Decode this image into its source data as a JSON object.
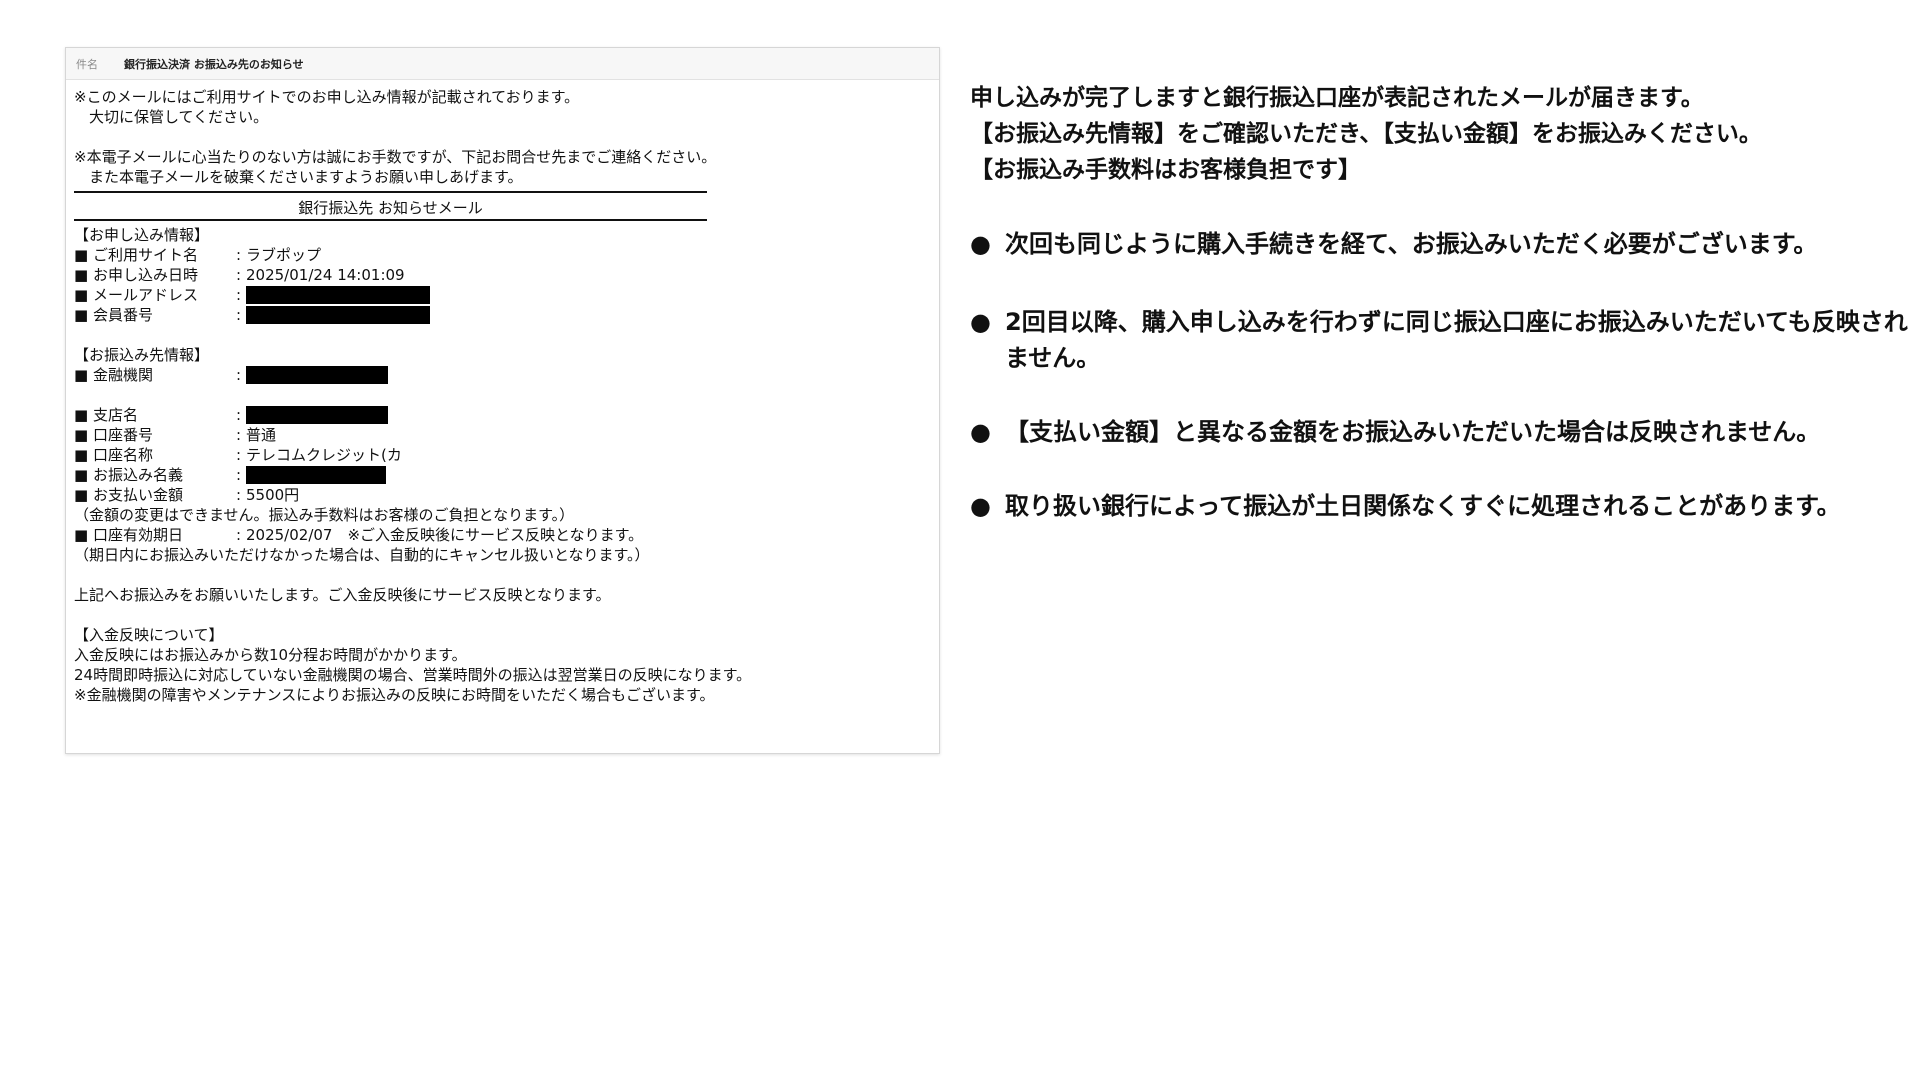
{
  "mail": {
    "subject_label": "件名",
    "subject": "銀行振込決済 お振込み先のお知らせ",
    "lines_top": [
      "※このメールにはご利用サイトでのお申し込み情報が記載されております。",
      "　大切に保管してください。",
      "",
      "※本電子メールに心当たりのない方は誠にお手数ですが、下記お問合せ先までご連絡ください。",
      "　また本電子メールを破棄くださいますようお願い申しあげます。"
    ],
    "banner": "銀行振込先 お知らせメール",
    "application_heading": "【お申し込み情報】",
    "application_rows": [
      {
        "key": "■ ご利用サイト名",
        "value": "ラブポップ"
      },
      {
        "key": "■ お申し込み日時",
        "value": "2025/01/24 14:01:09"
      },
      {
        "key": "■ メールアドレス",
        "value": ""
      },
      {
        "key": "■ 会員番号",
        "value": ""
      }
    ],
    "transfer_heading": "【お振込み先情報】",
    "transfer_rows": [
      {
        "key": "■ 金融機関",
        "value": ""
      },
      {
        "key": "■ 支店名",
        "value": ""
      },
      {
        "key": "■ 口座番号",
        "value": "普通"
      },
      {
        "key": "■ 口座名称",
        "value": "テレコムクレジット(カ"
      },
      {
        "key": "■ お振込み名義",
        "value": ""
      },
      {
        "key": "■ お支払い金額",
        "value": "5500円"
      }
    ],
    "amount_note": "（金額の変更はできません。振込み手数料はお客様のご負担となります。）",
    "expiry_key": "■ 口座有効期日",
    "expiry_value": "2025/02/07　※ご入金反映後にサービス反映となります。",
    "expiry_note": "（期日内にお振込みいただけなかった場合は、自動的にキャンセル扱いとなります。）",
    "request_line": "上記へお振込みをお願いいたします。ご入金反映後にサービス反映となります。",
    "reflection_heading": "【入金反映について】",
    "reflection_lines": [
      "入金反映にはお振込みから数10分程お時間がかかります。",
      "24時間即時振込に対応していない金融機関の場合、営業時間外の振込は翌営業日の反映になります。",
      "※金融機関の障害やメンテナンスによりお振込みの反映にお時間をいただく場合もございます。"
    ],
    "separator": ":"
  },
  "notes": {
    "intro": [
      "申し込みが完了しますと銀行振込口座が表記されたメールが届きます。",
      "【お振込み先情報】をご確認いただき、【支払い金額】をお振込みください。",
      "【お振込み手数料はお客様負担です】"
    ],
    "bullet_symbol": "●",
    "bullets": [
      "次回も同じように購入手続きを経て、お振込みいただく必要がございます。",
      "2回目以降、購入申し込みを行わずに同じ振込口座にお振込みいただいても反映されません。",
      "【支払い金額】と異なる金額をお振込みいただいた場合は反映されません。",
      "取り扱い銀行によって振込が土日関係なくすぐに処理されることがあります。"
    ]
  }
}
